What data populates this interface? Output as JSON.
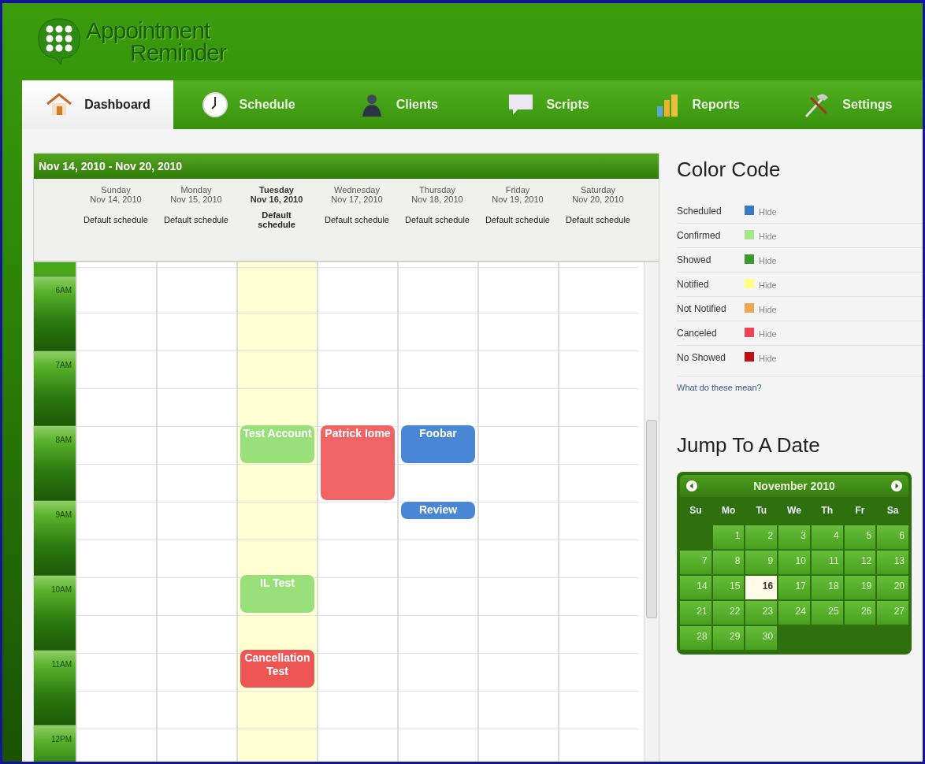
{
  "logo": {
    "line1": "Appointment",
    "line2": "Reminder"
  },
  "tabs": [
    {
      "label": "Dashboard",
      "selected": true
    },
    {
      "label": "Schedule",
      "selected": false
    },
    {
      "label": "Clients",
      "selected": false
    },
    {
      "label": "Scripts",
      "selected": false
    },
    {
      "label": "Reports",
      "selected": false
    },
    {
      "label": "Settings",
      "selected": false
    }
  ],
  "week": {
    "title": "Nov 14, 2010 - Nov 20, 2010",
    "hours": [
      "6AM",
      "7AM",
      "8AM",
      "9AM",
      "10AM",
      "11AM",
      "12PM"
    ],
    "days": [
      {
        "name": "Sunday",
        "date": "Nov 14, 2010",
        "schedule": "Default schedule",
        "today": false
      },
      {
        "name": "Monday",
        "date": "Nov 15, 2010",
        "schedule": "Default schedule",
        "today": false
      },
      {
        "name": "Tuesday",
        "date": "Nov 16, 2010",
        "schedule": "Default schedule",
        "today": true,
        "events": [
          {
            "title": "Test Account",
            "color": "#99e07a"
          },
          {
            "title": "IL Test",
            "color": "#99e07a"
          },
          {
            "title": "Cancellation Test",
            "color": "#ee5555"
          }
        ]
      },
      {
        "name": "Wednesday",
        "date": "Nov 17, 2010",
        "schedule": "Default schedule",
        "today": false,
        "events": [
          {
            "title": "Patrick Iome",
            "color": "#f06466"
          }
        ]
      },
      {
        "name": "Thursday",
        "date": "Nov 18, 2010",
        "schedule": "Default schedule",
        "today": false,
        "events": [
          {
            "title": "Foobar",
            "color": "#4a86d6"
          },
          {
            "title": "Review",
            "color": "#4a86d6"
          }
        ]
      },
      {
        "name": "Friday",
        "date": "Nov 19, 2010",
        "schedule": "Default schedule",
        "today": false
      },
      {
        "name": "Saturday",
        "date": "Nov 20, 2010",
        "schedule": "Default schedule",
        "today": false
      }
    ]
  },
  "color_code": {
    "title": "Color Code",
    "items": [
      {
        "label": "Scheduled",
        "color": "#3a78c8",
        "action": "Hide"
      },
      {
        "label": "Confirmed",
        "color": "#a4e88c",
        "action": "Hide"
      },
      {
        "label": "Showed",
        "color": "#3a9a2a",
        "action": "Hide"
      },
      {
        "label": "Notified",
        "color": "#ffff88",
        "action": "Hide"
      },
      {
        "label": "Not Notified",
        "color": "#f0a850",
        "action": "Hide"
      },
      {
        "label": "Canceled",
        "color": "#ee4455",
        "action": "Hide"
      },
      {
        "label": "No Showed",
        "color": "#c01010",
        "action": "Hide"
      }
    ],
    "help_link": "What do these mean?"
  },
  "jump": {
    "title": "Jump To A Date",
    "month": "November 2010",
    "weekdays": [
      "Su",
      "Mo",
      "Tu",
      "We",
      "Th",
      "Fr",
      "Sa"
    ],
    "weeks": [
      [
        {
          "day": "1",
          "selected": false
        },
        {
          "day": "2",
          "selected": false
        },
        {
          "day": "3",
          "selected": false
        },
        {
          "day": "4",
          "selected": false
        },
        {
          "day": "5",
          "selected": false
        },
        {
          "day": "6",
          "selected": false
        }
      ],
      [
        {
          "day": "7",
          "selected": false
        },
        {
          "day": "8",
          "selected": false
        },
        {
          "day": "9",
          "selected": false
        },
        {
          "day": "10",
          "selected": false
        },
        {
          "day": "11",
          "selected": false
        },
        {
          "day": "12",
          "selected": false
        },
        {
          "day": "13",
          "selected": false
        }
      ],
      [
        {
          "day": "14",
          "selected": false
        },
        {
          "day": "15",
          "selected": false
        },
        {
          "day": "16",
          "selected": true
        },
        {
          "day": "17",
          "selected": false
        },
        {
          "day": "18",
          "selected": false
        },
        {
          "day": "19",
          "selected": false
        },
        {
          "day": "20",
          "selected": false
        }
      ],
      [
        {
          "day": "21",
          "selected": false
        },
        {
          "day": "22",
          "selected": false
        },
        {
          "day": "23",
          "selected": false
        },
        {
          "day": "24",
          "selected": false
        },
        {
          "day": "25",
          "selected": false
        },
        {
          "day": "26",
          "selected": false
        },
        {
          "day": "27",
          "selected": false
        }
      ],
      [
        {
          "day": "28",
          "selected": false
        },
        {
          "day": "29",
          "selected": false
        },
        {
          "day": "30",
          "selected": false
        }
      ]
    ]
  }
}
